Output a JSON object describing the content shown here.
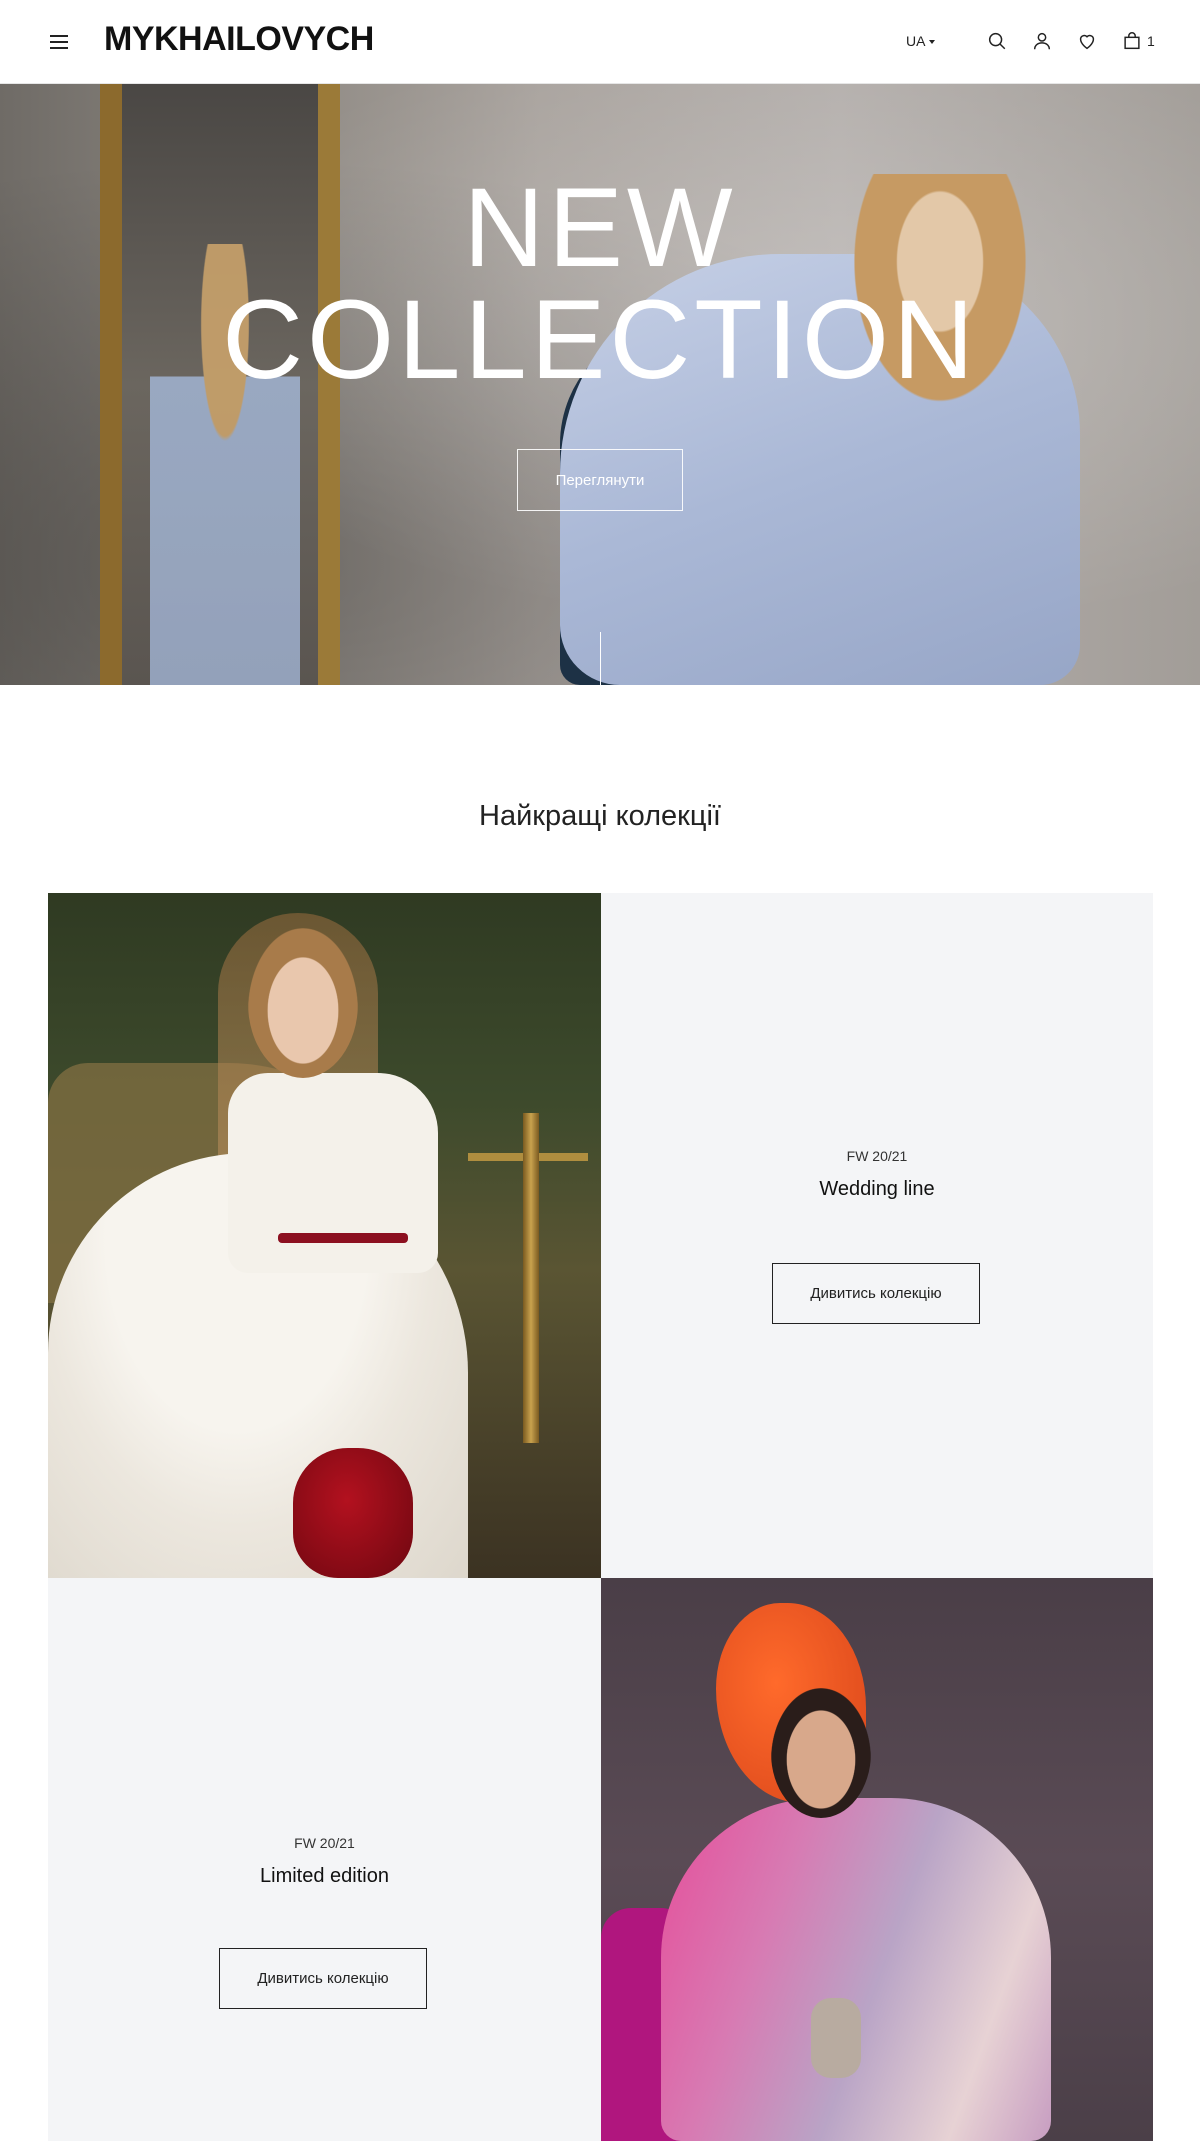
{
  "header": {
    "logo": "MYKHAILOVYCH",
    "language": "UA",
    "cart_count": "1"
  },
  "hero": {
    "title_line1": "NEW",
    "title_line2": "COLLECTION",
    "button_label": "Переглянути"
  },
  "section": {
    "title": "Найкращі колекції"
  },
  "collections": [
    {
      "season": "FW 20/21",
      "name": "Wedding line",
      "button_label": "Дивитись колекцію"
    },
    {
      "season": "FW 20/21",
      "name": "Limited edition",
      "button_label": "Дивитись колекцію"
    }
  ],
  "icons": {
    "menu": "menu-icon",
    "search": "search-icon",
    "account": "user-icon",
    "wishlist": "heart-icon",
    "cart": "bag-icon"
  },
  "colors": {
    "text": "#1a1a1a",
    "tile_background": "#f4f5f7",
    "hero_text": "#ffffff"
  }
}
